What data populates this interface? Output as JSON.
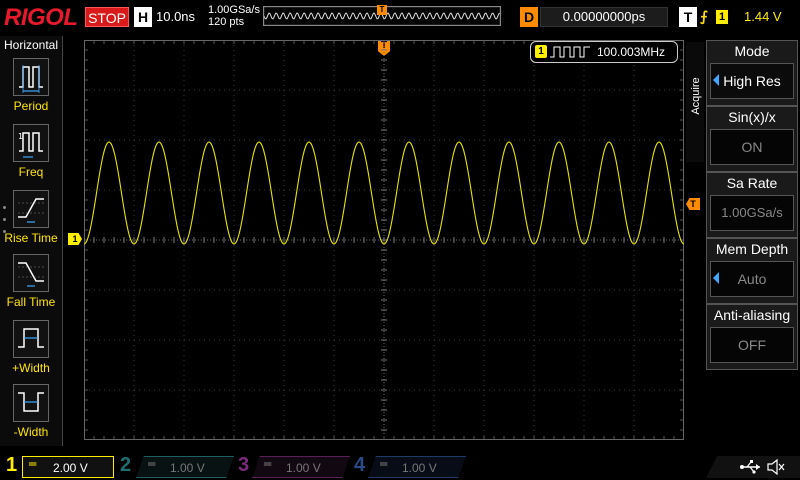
{
  "brand": "RIGOL",
  "status": {
    "run_state": "STOP"
  },
  "horizontal": {
    "label": "H",
    "timebase": "10.0ns",
    "sample_rate": "1.00GSa/s",
    "points": "120  pts"
  },
  "delay": {
    "label": "D",
    "value": "0.00000000ps"
  },
  "trigger": {
    "label": "T",
    "edge_symbol": "⨍",
    "source": "1",
    "level": "1.44 V",
    "marker": "T"
  },
  "left_menu": {
    "title": "Horizontal",
    "items": [
      {
        "label": "Period",
        "icon": "period-icon"
      },
      {
        "label": "Freq",
        "icon": "frequency-icon"
      },
      {
        "label": "Rise Time",
        "icon": "rise-time-icon"
      },
      {
        "label": "Fall Time",
        "icon": "fall-time-icon"
      },
      {
        "label": "+Width",
        "icon": "positive-width-icon"
      },
      {
        "label": "-Width",
        "icon": "negative-width-icon"
      }
    ]
  },
  "measurement": {
    "channel": "1",
    "icon": "pulse-train-icon",
    "value": "100.003MHz"
  },
  "waveform": {
    "channel": "1",
    "color": "#e6e600",
    "cycles_on_screen": 12,
    "ch1_marker": "1"
  },
  "right_menu": {
    "tab": "Acquire",
    "items": [
      {
        "title": "Mode",
        "value": "High Res",
        "active": true,
        "arrow": true
      },
      {
        "title": "Sin(x)/x",
        "value": "ON",
        "active": false,
        "arrow": false
      },
      {
        "title": "Sa Rate",
        "value": "1.00GSa/s",
        "active": false,
        "arrow": false
      },
      {
        "title": "Mem Depth",
        "value": "Auto",
        "active": false,
        "arrow": true
      },
      {
        "title": "Anti-aliasing",
        "value": "OFF",
        "active": false,
        "arrow": false
      }
    ]
  },
  "channels": [
    {
      "num": "1",
      "coupling": "═",
      "scale": "2.00 V",
      "color": "#ffee00",
      "enabled": true
    },
    {
      "num": "2",
      "coupling": "═",
      "scale": "1.00 V",
      "color": "#00c0c0",
      "enabled": false
    },
    {
      "num": "3",
      "coupling": "═",
      "scale": "1.00 V",
      "color": "#ff40ff",
      "enabled": false
    },
    {
      "num": "4",
      "coupling": "═",
      "scale": "1.00 V",
      "color": "#3f7fff",
      "enabled": false
    }
  ],
  "status_icons": [
    "usb-icon",
    "speaker-icon"
  ],
  "colors": {
    "ch1": "#ffee00",
    "trigger": "#ff8c00",
    "stop": "#d81a1a",
    "accent": "#3fa9ff"
  }
}
